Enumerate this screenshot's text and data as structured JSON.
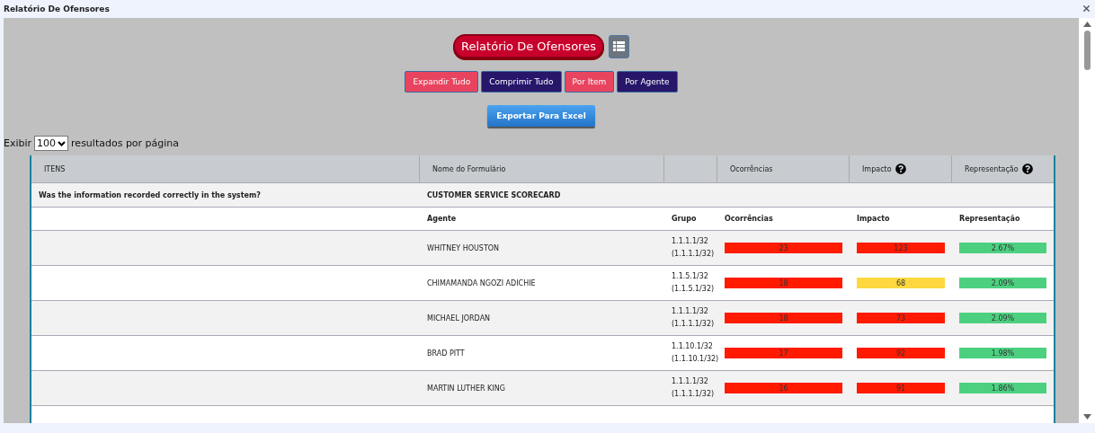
{
  "window": {
    "title": "Relatório De Ofensores"
  },
  "report_title": "Relatório De Ofensores",
  "buttons": [
    {
      "label": "Expandir Tudo",
      "kind": "pink"
    },
    {
      "label": "Comprimir Tudo",
      "kind": "navy"
    },
    {
      "label": "Por Item",
      "kind": "pink"
    },
    {
      "label": "Por Agente",
      "kind": "navy"
    }
  ],
  "export_button": "Exportar Para Excel",
  "page_size": {
    "prefix": "Exibir",
    "value": "100",
    "suffix": "resultados por página"
  },
  "table": {
    "columns": [
      {
        "label": "ITENS",
        "help": false
      },
      {
        "label": "Nome do Formulário",
        "help": false
      },
      {
        "help": false
      },
      {
        "label": "Ocorrências",
        "help": false
      },
      {
        "label": "Impacto",
        "help": true
      },
      {
        "label": "Representação",
        "help": true
      }
    ],
    "item": {
      "question": "Was the information recorded correctly in the system?",
      "form": "CUSTOMER SERVICE SCORECARD"
    },
    "sub_columns": [
      "Agente",
      "Grupo",
      "Ocorrências",
      "Impacto",
      "Representação"
    ],
    "rows": [
      {
        "agent": "WHITNEY HOUSTON",
        "group": [
          "1.1.1.1/32",
          "(1.1.1.1/32)"
        ],
        "occurrences": {
          "value": "23",
          "color": "#ff1a00"
        },
        "impact": {
          "value": "123",
          "color": "#ff1a00"
        },
        "representation": {
          "value": "2.67%",
          "color": "#4cd080"
        }
      },
      {
        "agent": "CHIMAMANDA NGOZI ADICHIE",
        "group": [
          "1.1.5.1/32",
          "(1.1.5.1/32)"
        ],
        "occurrences": {
          "value": "18",
          "color": "#ff1a00"
        },
        "impact": {
          "value": "68",
          "color": "#fdd83f"
        },
        "representation": {
          "value": "2.09%",
          "color": "#4cd080"
        }
      },
      {
        "agent": "MICHAEL JORDAN",
        "group": [
          "1.1.1.1/32",
          "(1.1.1.1/32)"
        ],
        "occurrences": {
          "value": "18",
          "color": "#ff1a00"
        },
        "impact": {
          "value": "73",
          "color": "#ff1a00"
        },
        "representation": {
          "value": "2.09%",
          "color": "#4cd080"
        }
      },
      {
        "agent": "BRAD PITT",
        "group": [
          "1.1.10.1/32",
          "(1.1.10.1/32)"
        ],
        "occurrences": {
          "value": "17",
          "color": "#ff1a00"
        },
        "impact": {
          "value": "92",
          "color": "#ff1a00"
        },
        "representation": {
          "value": "1.98%",
          "color": "#4cd080"
        }
      },
      {
        "agent": "MARTIN LUTHER KING",
        "group": [
          "1.1.1.1/32",
          "(1.1.1.1/32)"
        ],
        "occurrences": {
          "value": "16",
          "color": "#ff1a00"
        },
        "impact": {
          "value": "91",
          "color": "#ff1a00"
        },
        "representation": {
          "value": "1.86%",
          "color": "#4cd080"
        }
      }
    ]
  }
}
